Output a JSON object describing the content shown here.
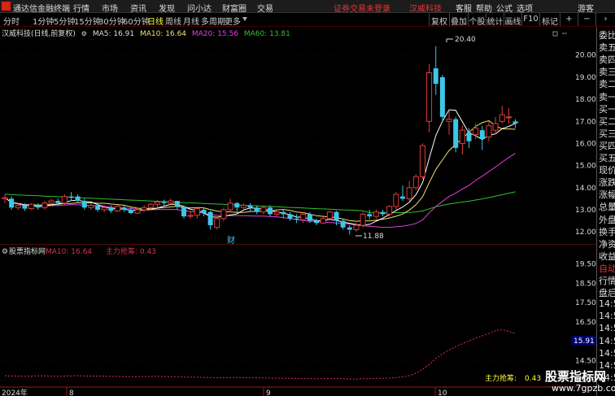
{
  "menubar": {
    "app_name": "通达信金融终端",
    "items": [
      "行情",
      "市场",
      "资讯",
      "发现",
      "问小达",
      "财富圈",
      "交易"
    ],
    "notice": "证券交易未登录",
    "stock_name": "汉威科技",
    "right_items": [
      "客服",
      "帮助",
      "公式",
      "选项"
    ],
    "guest": "游客"
  },
  "toolbar": {
    "periods": [
      "分时",
      "1分钟",
      "5分钟",
      "15分钟",
      "30分钟",
      "60分钟",
      "日线",
      "周线",
      "月线",
      "多周期",
      "更多"
    ],
    "active_period": "日线",
    "buttons": [
      "复权",
      "叠加",
      "个股",
      "统计",
      "画线",
      "F10",
      "标记"
    ]
  },
  "info": {
    "title": "汉威科技(日线,前复权)",
    "ma5": "MA5: 16.91",
    "ma10": "MA10: 16.64",
    "ma20": "MA20: 15.56",
    "ma60": "MA60: 13.81"
  },
  "kline": {
    "price_ticks": [
      "20.00",
      "19.00",
      "18.00",
      "17.00",
      "16.00",
      "15.00",
      "14.00",
      "13.00",
      "12.00"
    ],
    "high_label": "20.40",
    "low_label": "11.88",
    "cai_marker": "财"
  },
  "indicator": {
    "name": "股票指标网",
    "ma10": "MA10: 16.64",
    "zl": "主力抢筹: 0.43",
    "ticks": [
      "19.50",
      "18.50",
      "17.50",
      "16.50",
      "15.50",
      "14.50",
      "13.50"
    ],
    "current_value": "15.91",
    "bottom_label": "主力抢筹:",
    "bottom_value": "0.43"
  },
  "dates": [
    "2024年",
    "8",
    "9",
    "10"
  ],
  "right_panel": [
    {
      "label": "委比",
      "red": false
    },
    {
      "label": "卖五",
      "red": false
    },
    {
      "label": "卖四",
      "red": false
    },
    {
      "label": "卖三",
      "red": false
    },
    {
      "label": "卖二",
      "red": false
    },
    {
      "label": "卖一",
      "red": false
    },
    {
      "label": "买一",
      "red": false
    },
    {
      "label": "买二",
      "red": false
    },
    {
      "label": "买三",
      "red": false
    },
    {
      "label": "买四",
      "red": false
    },
    {
      "label": "买五",
      "red": false
    },
    {
      "label": "现价",
      "red": false
    },
    {
      "label": "涨跌",
      "red": false
    },
    {
      "label": "涨幅",
      "red": false
    },
    {
      "label": "总量",
      "red": false
    },
    {
      "label": "外盘",
      "red": false
    },
    {
      "label": "换手",
      "red": false
    },
    {
      "label": "净资",
      "red": false
    },
    {
      "label": "收益",
      "red": false
    },
    {
      "label": "自动",
      "red": true
    },
    {
      "label": "行情",
      "red": false
    },
    {
      "label": "盘后",
      "red": false
    },
    {
      "label": "14:50",
      "red": false
    },
    {
      "label": "14:50",
      "red": false
    },
    {
      "label": "14:50",
      "red": false
    },
    {
      "label": "14:50",
      "red": false
    },
    {
      "label": "14:50",
      "red": false
    },
    {
      "label": "14:50",
      "red": false
    },
    {
      "label": "14:50",
      "red": false
    }
  ],
  "watermark": {
    "title": "股票指标网",
    "url": "www.7gpzb.com"
  },
  "colors": {
    "up": "#e23b3b",
    "down": "#3ec6e6",
    "ma5": "#ffffff",
    "ma10": "#f0e070",
    "ma20": "#e040e0",
    "ma60": "#30c030",
    "zl_line": "#e03050"
  },
  "chart_data": {
    "type": "candlestick",
    "candles": [
      [
        13.5,
        13.55,
        13.7,
        13.3
      ],
      [
        13.5,
        13.1,
        13.6,
        13.0
      ],
      [
        13.1,
        13.2,
        13.3,
        13.0
      ],
      [
        13.2,
        13.05,
        13.3,
        12.95
      ],
      [
        13.05,
        13.25,
        13.3,
        13.0
      ],
      [
        13.2,
        13.1,
        13.3,
        13.0
      ],
      [
        13.1,
        13.3,
        13.4,
        13.0
      ],
      [
        13.3,
        13.4,
        13.5,
        13.2
      ],
      [
        13.4,
        13.3,
        13.5,
        13.2
      ],
      [
        13.3,
        13.6,
        13.7,
        13.2
      ],
      [
        13.6,
        13.55,
        13.8,
        13.4
      ],
      [
        13.6,
        13.4,
        13.7,
        13.3
      ],
      [
        13.4,
        13.1,
        13.5,
        13.0
      ],
      [
        13.1,
        13.2,
        13.3,
        13.0
      ],
      [
        13.2,
        13.0,
        13.3,
        12.9
      ],
      [
        13.0,
        13.1,
        13.2,
        12.9
      ],
      [
        13.1,
        12.95,
        13.2,
        12.85
      ],
      [
        12.95,
        13.15,
        13.2,
        12.9
      ],
      [
        13.1,
        13.0,
        13.2,
        12.9
      ],
      [
        13.0,
        12.85,
        13.1,
        12.8
      ],
      [
        12.85,
        13.0,
        13.1,
        12.8
      ],
      [
        13.0,
        13.1,
        13.2,
        12.9
      ],
      [
        13.1,
        13.25,
        13.3,
        13.0
      ],
      [
        13.25,
        13.35,
        13.45,
        13.1
      ],
      [
        13.35,
        13.3,
        13.45,
        13.2
      ],
      [
        13.3,
        13.4,
        13.5,
        13.2
      ],
      [
        13.4,
        13.15,
        13.4,
        13.0
      ],
      [
        13.15,
        12.7,
        13.2,
        12.6
      ],
      [
        12.7,
        12.75,
        12.9,
        12.6
      ],
      [
        12.75,
        13.05,
        13.1,
        12.6
      ],
      [
        13.0,
        12.85,
        13.1,
        12.7
      ],
      [
        12.9,
        12.3,
        12.95,
        12.1
      ],
      [
        12.2,
        12.6,
        12.7,
        12.1
      ],
      [
        12.6,
        13.0,
        13.1,
        12.5
      ],
      [
        13.0,
        13.3,
        13.5,
        12.9
      ],
      [
        13.3,
        13.1,
        13.35,
        12.9
      ],
      [
        13.1,
        13.2,
        13.3,
        13.0
      ],
      [
        13.2,
        13.1,
        13.3,
        12.9
      ],
      [
        13.1,
        12.9,
        13.2,
        12.8
      ],
      [
        12.9,
        13.1,
        13.2,
        12.8
      ],
      [
        13.1,
        12.8,
        13.2,
        12.7
      ],
      [
        12.8,
        12.9,
        13.0,
        12.7
      ],
      [
        12.9,
        12.8,
        13.0,
        12.6
      ],
      [
        12.8,
        12.6,
        12.9,
        12.5
      ],
      [
        12.6,
        12.55,
        12.8,
        12.4
      ],
      [
        12.55,
        12.8,
        12.9,
        12.4
      ],
      [
        12.8,
        12.5,
        12.9,
        12.4
      ],
      [
        12.5,
        12.4,
        12.6,
        12.3
      ],
      [
        12.4,
        12.6,
        12.75,
        12.35
      ],
      [
        12.6,
        12.9,
        12.95,
        12.5
      ],
      [
        12.9,
        12.5,
        12.95,
        12.3
      ],
      [
        12.5,
        12.2,
        12.55,
        12.1
      ],
      [
        12.2,
        12.1,
        12.3,
        11.88
      ],
      [
        12.1,
        12.3,
        12.4,
        12.0
      ],
      [
        12.3,
        12.8,
        12.9,
        12.2
      ],
      [
        12.8,
        12.7,
        13.0,
        12.55
      ],
      [
        12.7,
        12.9,
        13.0,
        12.6
      ],
      [
        12.9,
        12.8,
        13.0,
        12.7
      ],
      [
        12.8,
        13.15,
        13.2,
        12.7
      ],
      [
        13.15,
        13.7,
        13.8,
        13.0
      ],
      [
        13.6,
        13.5,
        14.1,
        13.4
      ],
      [
        13.5,
        14.0,
        14.3,
        13.4
      ],
      [
        14.0,
        14.5,
        14.6,
        13.9
      ],
      [
        14.5,
        15.9,
        16.0,
        14.4
      ],
      [
        17.0,
        19.2,
        19.6,
        16.5
      ],
      [
        19.4,
        18.7,
        20.4,
        18.2
      ],
      [
        19.0,
        17.2,
        19.1,
        17.0
      ],
      [
        17.0,
        17.1,
        17.5,
        16.4
      ],
      [
        17.1,
        15.8,
        17.2,
        15.6
      ],
      [
        16.0,
        16.6,
        16.8,
        15.5
      ],
      [
        16.5,
        16.1,
        16.7,
        15.8
      ],
      [
        16.4,
        16.7,
        16.9,
        16.2
      ],
      [
        16.6,
        16.2,
        16.8,
        15.7
      ],
      [
        16.3,
        16.8,
        17.0,
        16.1
      ],
      [
        16.6,
        16.9,
        17.2,
        16.4
      ],
      [
        17.0,
        17.3,
        17.7,
        16.9
      ],
      [
        17.2,
        17.2,
        17.6,
        16.9
      ],
      [
        17.0,
        16.9,
        17.1,
        16.7
      ]
    ],
    "ma5_end": 16.91,
    "ma10_end": 16.64,
    "ma20_end": 15.56,
    "ma60_end": 13.81,
    "y_range": [
      11.6,
      20.8
    ],
    "zl_values": [
      13.72,
      13.7,
      13.7,
      13.69,
      13.7,
      13.71,
      13.71,
      13.7,
      13.69,
      13.7,
      13.71,
      13.72,
      13.71,
      13.7,
      13.7,
      13.69,
      13.69,
      13.68,
      13.68,
      13.67,
      13.67,
      13.68,
      13.68,
      13.69,
      13.68,
      13.67,
      13.66,
      13.65,
      13.64,
      13.64,
      13.63,
      13.62,
      13.61,
      13.61,
      13.62,
      13.63,
      13.62,
      13.61,
      13.61,
      13.6,
      13.6,
      13.59,
      13.58,
      13.58,
      13.57,
      13.57,
      13.56,
      13.56,
      13.56,
      13.57,
      13.57,
      13.56,
      13.55,
      13.55,
      13.56,
      13.57,
      13.58,
      13.58,
      13.6,
      13.62,
      13.66,
      13.72,
      13.85,
      14.05,
      14.3,
      14.62,
      14.85,
      15.05,
      15.22,
      15.38,
      15.52,
      15.66,
      15.78,
      15.9,
      16.05,
      16.1,
      16.02,
      15.91
    ],
    "zl_range": [
      13.3,
      20.2
    ]
  }
}
